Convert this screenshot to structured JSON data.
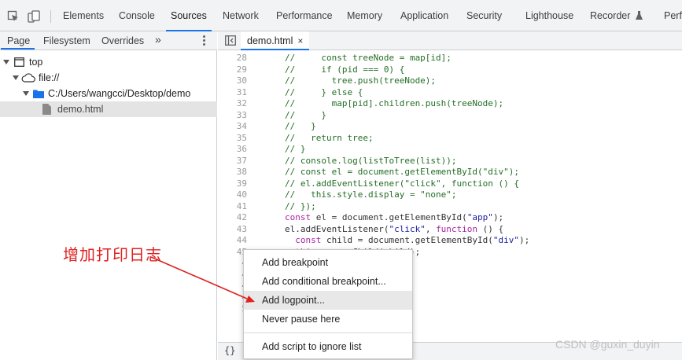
{
  "devtools": {
    "tabs": [
      {
        "label": "Elements",
        "active": false
      },
      {
        "label": "Console",
        "active": false
      },
      {
        "label": "Sources",
        "active": true
      },
      {
        "label": "Network",
        "active": false
      },
      {
        "label": "Performance",
        "active": false
      },
      {
        "label": "Memory",
        "active": false
      },
      {
        "label": "Application",
        "active": false
      },
      {
        "label": "Security",
        "active": false
      },
      {
        "label": "Lighthouse",
        "active": false
      },
      {
        "label": "Recorder",
        "active": false
      },
      {
        "label": "Perfo",
        "active": false
      }
    ],
    "icons": {
      "inspect": "inspect-element-icon",
      "device": "device-toolbar-icon",
      "recorder": "flask-icon"
    }
  },
  "navigator": {
    "tabs": [
      "Page",
      "Filesystem",
      "Overrides"
    ],
    "more": "»",
    "tree": [
      {
        "label": "top",
        "icon": "frame-icon"
      },
      {
        "label": "file://",
        "icon": "cloud-icon"
      },
      {
        "label": "C:/Users/wangcci/Desktop/demo",
        "icon": "folder-icon"
      },
      {
        "label": "demo.html",
        "icon": "file-icon",
        "selected": true
      }
    ]
  },
  "editor": {
    "file_tab": "demo.html",
    "close": "×",
    "format_button": "{}",
    "lines": [
      {
        "n": "28",
        "text": "//     const treeNode = map[id];",
        "type": "comment"
      },
      {
        "n": "29",
        "text": "//     if (pid === 0) {",
        "type": "comment"
      },
      {
        "n": "30",
        "text": "//       tree.push(treeNode);",
        "type": "comment"
      },
      {
        "n": "31",
        "text": "//     } else {",
        "type": "comment"
      },
      {
        "n": "32",
        "text": "//       map[pid].children.push(treeNode);",
        "type": "comment"
      },
      {
        "n": "33",
        "text": "//     }",
        "type": "comment"
      },
      {
        "n": "34",
        "text": "//   }",
        "type": "comment"
      },
      {
        "n": "35",
        "text": "//   return tree;",
        "type": "comment"
      },
      {
        "n": "36",
        "text": "// }",
        "type": "comment"
      },
      {
        "n": "37",
        "text": "// console.log(listToTree(list));",
        "type": "comment"
      },
      {
        "n": "38",
        "text": "// const el = document.getElementById(\"div\");",
        "type": "comment"
      },
      {
        "n": "39",
        "text": "// el.addEventListener(\"click\", function () {",
        "type": "comment"
      },
      {
        "n": "40",
        "text": "//   this.style.display = \"none\";",
        "type": "comment"
      },
      {
        "n": "41",
        "text": "// });",
        "type": "comment"
      },
      {
        "n": "42",
        "text": "const el = document.getElementById(\"app\");",
        "type": "code"
      },
      {
        "n": "43",
        "text": "el.addEventListener(\"click\", function () {",
        "type": "code"
      },
      {
        "n": "44",
        "text": "  const child = document.getElementById(\"div\");",
        "type": "code"
      },
      {
        "n": "45",
        "text": "  this.removeChild(child);",
        "type": "code"
      },
      {
        "n": "4",
        "text": "",
        "type": "code"
      },
      {
        "n": "4",
        "text": "",
        "type": "code"
      },
      {
        "n": "4",
        "text": "",
        "type": "code"
      },
      {
        "n": "4",
        "text": "",
        "type": "code"
      },
      {
        "n": "5",
        "text": "",
        "type": "code"
      }
    ]
  },
  "context_menu": {
    "items": [
      {
        "label": "Add breakpoint"
      },
      {
        "label": "Add conditional breakpoint..."
      },
      {
        "label": "Add logpoint...",
        "hovered": true
      },
      {
        "label": "Never pause here"
      },
      {
        "label": "Add script to ignore list"
      }
    ]
  },
  "annotation": {
    "text": "增加打印日志",
    "color": "#e02020"
  },
  "watermark": "CSDN @guxin_duyin"
}
